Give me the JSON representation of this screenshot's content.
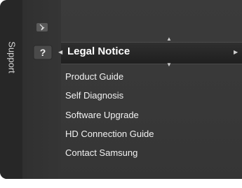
{
  "sidebar": {
    "label": "Support"
  },
  "menu": {
    "selected": "Legal Notice",
    "items": [
      "Product Guide",
      "Self Diagnosis",
      "Software Upgrade",
      "HD Connection Guide",
      "Contact Samsung"
    ]
  },
  "icons": {
    "top": "settings-icon",
    "active": "help-question-icon",
    "nav_left": "left-arrow-icon",
    "nav_right": "right-arrow-icon",
    "nav_up": "up-arrow-icon",
    "nav_down": "down-arrow-icon"
  },
  "colors": {
    "background": "#383838",
    "sidebar": "#272727",
    "text": "#f2f2f2",
    "selected_bar": "#1f1f1f"
  }
}
